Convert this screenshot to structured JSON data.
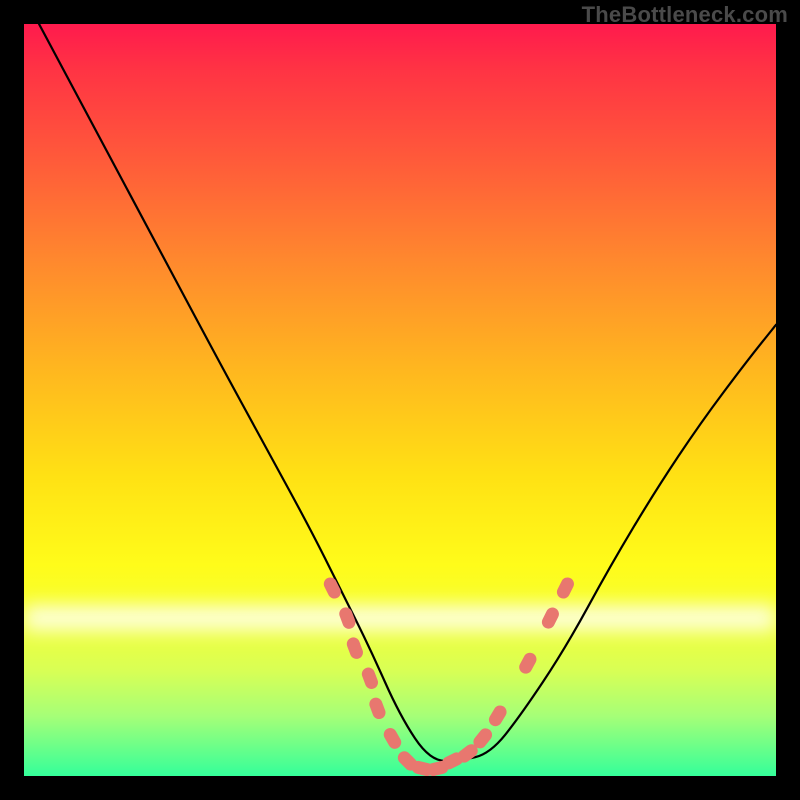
{
  "watermark": "TheBottleneck.com",
  "chart_data": {
    "type": "line",
    "title": "",
    "xlabel": "",
    "ylabel": "",
    "xlim": [
      0,
      100
    ],
    "ylim": [
      0,
      100
    ],
    "grid": false,
    "series": [
      {
        "name": "curve",
        "x": [
          2,
          10,
          18,
          26,
          32,
          38,
          42,
          46,
          50,
          54,
          58,
          62,
          66,
          72,
          78,
          84,
          90,
          96,
          100
        ],
        "values": [
          100,
          85,
          70,
          55,
          44,
          33,
          25,
          17,
          8,
          2,
          2,
          3,
          8,
          17,
          28,
          38,
          47,
          55,
          60
        ]
      }
    ],
    "glow_band_y": 21,
    "markers": {
      "name": "salmon-dots",
      "color": "#e8776f",
      "points": [
        {
          "x": 41,
          "y": 25
        },
        {
          "x": 43,
          "y": 21
        },
        {
          "x": 44,
          "y": 17
        },
        {
          "x": 46,
          "y": 13
        },
        {
          "x": 47,
          "y": 9
        },
        {
          "x": 49,
          "y": 5
        },
        {
          "x": 51,
          "y": 2
        },
        {
          "x": 53,
          "y": 1
        },
        {
          "x": 55,
          "y": 1
        },
        {
          "x": 57,
          "y": 2
        },
        {
          "x": 59,
          "y": 3
        },
        {
          "x": 61,
          "y": 5
        },
        {
          "x": 63,
          "y": 8
        },
        {
          "x": 67,
          "y": 15
        },
        {
          "x": 70,
          "y": 21
        },
        {
          "x": 72,
          "y": 25
        }
      ]
    }
  }
}
